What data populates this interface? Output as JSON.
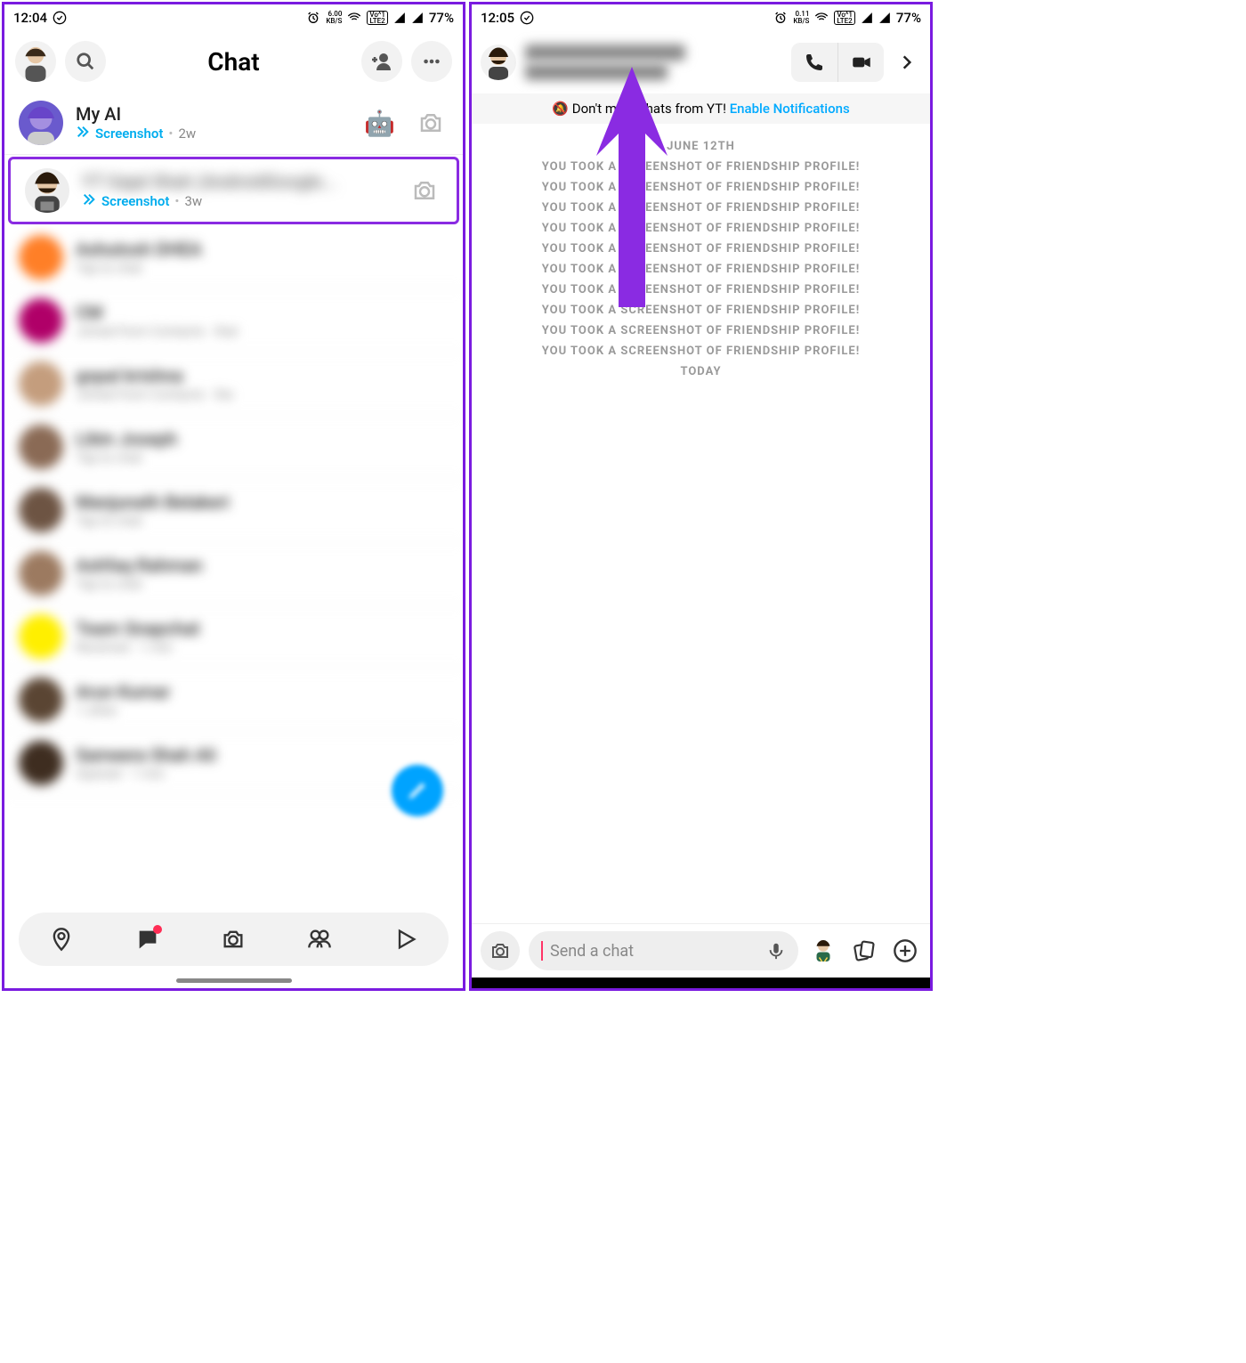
{
  "left": {
    "status": {
      "time": "12:04",
      "speed_top": "6.00",
      "speed_bottom": "KB/S",
      "battery": "77%"
    },
    "header": {
      "title": "Chat"
    },
    "my_ai": {
      "name": "My AI",
      "status_label": "Screenshot",
      "time": "2w",
      "emoji": "🤖"
    },
    "highlighted": {
      "name": "YT Gajal Shah (AndroidGoogle...",
      "status_label": "Screenshot",
      "time": "3w"
    },
    "blurred_rows": [
      {
        "name": "Ashutosh DHEA",
        "sub": "Tap to chat"
      },
      {
        "name": "CM",
        "sub": "Joined from Contacts · that"
      },
      {
        "name": "gopal krishna",
        "sub": "Joined from Contacts · the"
      },
      {
        "name": "Libin Joseph",
        "sub": "Tap to chat"
      },
      {
        "name": "Manjunath Belakeri",
        "sub": "Tap to chat"
      },
      {
        "name": "Ashfaq Rahman",
        "sub": "Tap to chat"
      },
      {
        "name": "Team Snapchat",
        "sub": "Received · 1 min"
      },
      {
        "name": "Arun Kumar",
        "sub": "1 other"
      },
      {
        "name": "Sameera Shah Ali",
        "sub": "Opened · 1 min"
      }
    ]
  },
  "right": {
    "status": {
      "time": "12:05",
      "speed_top": "0.11",
      "speed_bottom": "KB/S",
      "battery": "77%"
    },
    "notice": {
      "bell": "🔕",
      "text": "Don't miss Chats from YT! ",
      "link": "Enable Notifications"
    },
    "date1": "JUNE 12TH",
    "sys_line": "YOU TOOK A SCREENSHOT OF FRIENDSHIP PROFILE!",
    "sys_count": 10,
    "date2": "TODAY",
    "input": {
      "placeholder": "Send a chat"
    }
  }
}
